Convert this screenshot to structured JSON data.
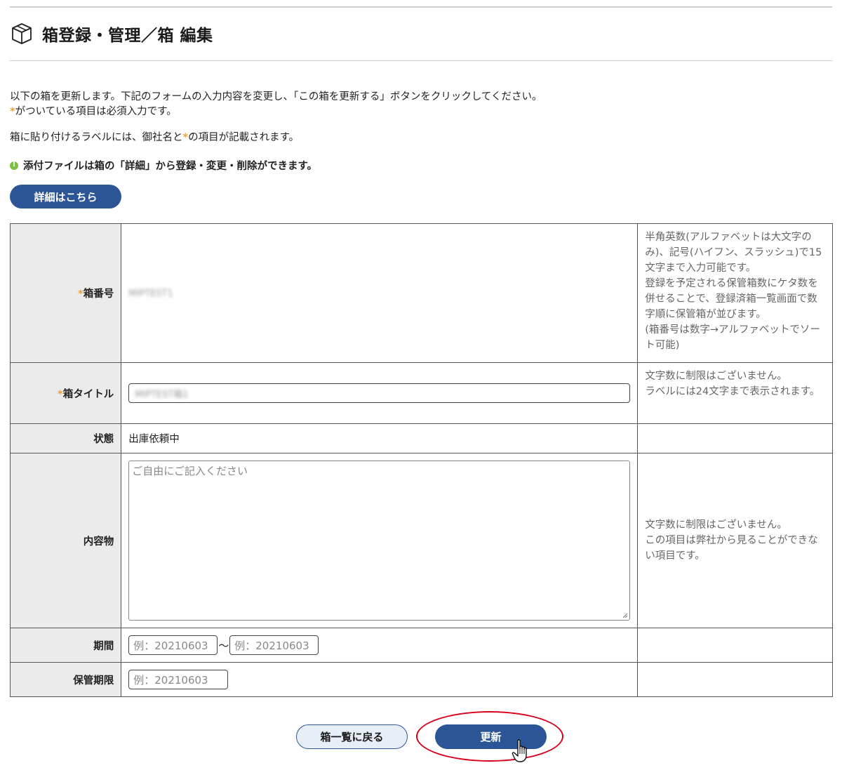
{
  "header": {
    "title": "箱登録・管理／箱 編集",
    "icon": "box-icon"
  },
  "intro": {
    "line1": "以下の箱を更新します。下記のフォームの入力内容を変更し、「この箱を更新する」ボタンをクリックしてください。",
    "required_mark": "*",
    "line2": "がついている項目は必須入力です。",
    "label_note_pre": "箱に貼り付けるラベルには、御社名と",
    "label_note_post": "の項目が記載されます。",
    "attachment_notice": "添付ファイルは箱の「詳細」から登録・変更・削除ができます。",
    "details_button": "詳細はこちら"
  },
  "form": {
    "box_number": {
      "label": "箱番号",
      "value": "MIPTEST1",
      "hint": "半角英数(アルファベットは大文字のみ)、記号(ハイフン、スラッシュ)で15文字まで入力可能です。\n登録を予定される保管箱数にケタ数を併せることで、登録済箱一覧画面で数字順に保管箱が並びます。\n(箱番号は数字→アルファベットでソート可能)"
    },
    "box_title": {
      "label": "箱タイトル",
      "value": "MIPTEST箱1",
      "hint": "文字数に制限はございません。\nラベルには24文字まで表示されます。"
    },
    "status": {
      "label": "状態",
      "value": "出庫依頼中"
    },
    "contents": {
      "label": "内容物",
      "placeholder": "ご自由にご記入ください",
      "hint": "文字数に制限はございません。\nこの項目は弊社から見ることができない項目です。"
    },
    "period": {
      "label": "期間",
      "from_placeholder": "例：20210603",
      "separator": "～",
      "to_placeholder": "例：20210603"
    },
    "retention": {
      "label": "保管期限",
      "placeholder": "例：20210603"
    }
  },
  "actions": {
    "back_label": "箱一覧に戻る",
    "update_label": "更新"
  },
  "colors": {
    "primary": "#2b5597",
    "required": "#f0a23a",
    "notice_dot": "#7dc142",
    "highlight": "#d9001b"
  }
}
